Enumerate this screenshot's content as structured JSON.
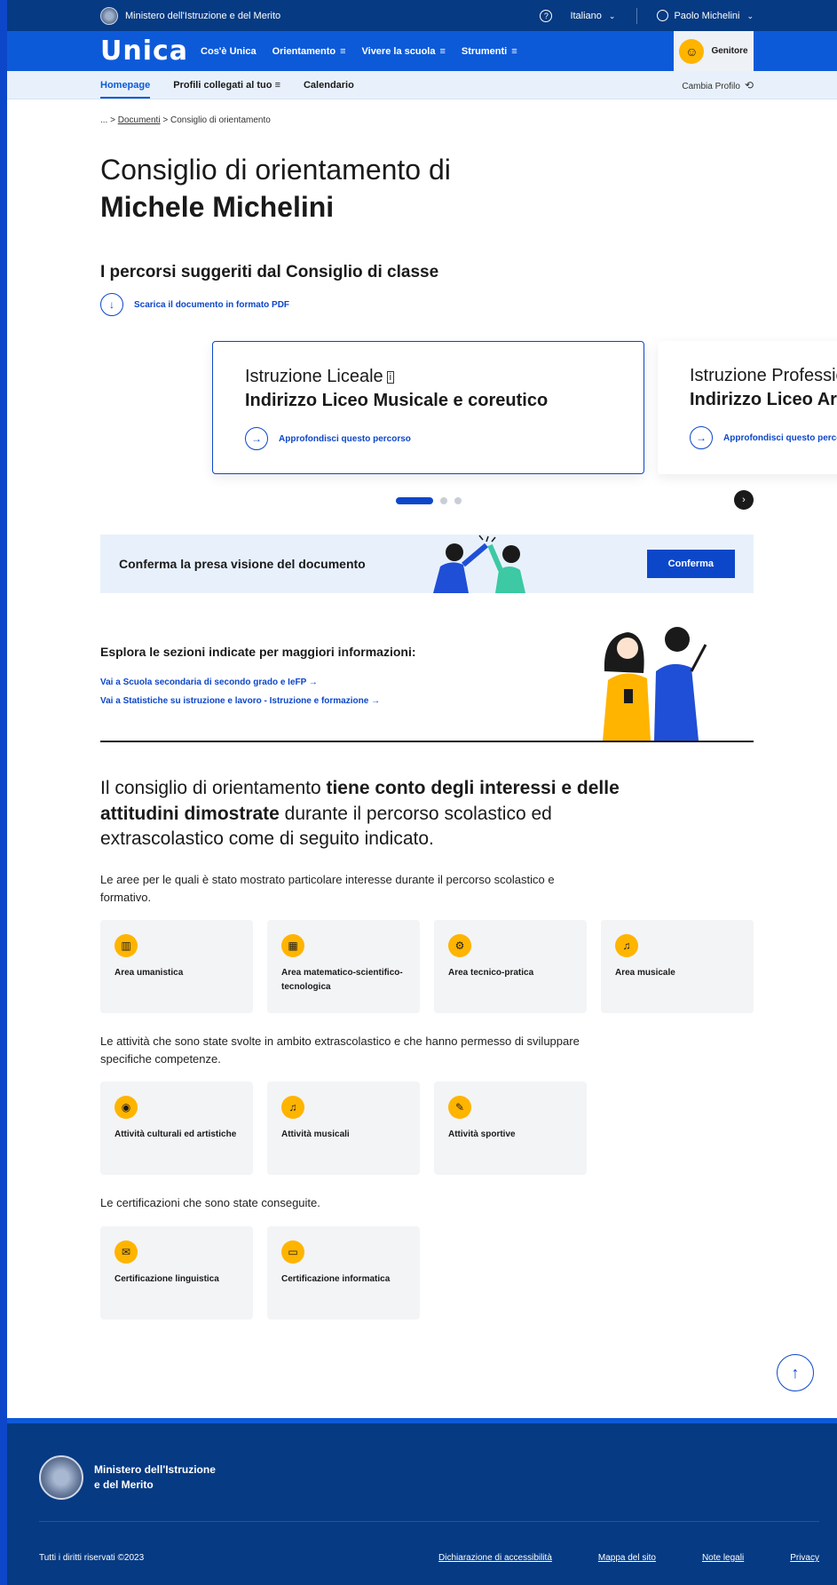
{
  "topbar": {
    "ministry": "Ministero dell'Istruzione e del Merito",
    "language": "Italiano",
    "user": "Paolo Michelini"
  },
  "header": {
    "logo": "Unica",
    "nav": [
      {
        "label": "Cos'è Unica"
      },
      {
        "label": "Orientamento"
      },
      {
        "label": "Vivere la scuola"
      },
      {
        "label": "Strumenti"
      }
    ],
    "role": "Genitore"
  },
  "subnav": {
    "items": [
      "Homepage",
      "Profili collegati al tuo",
      "Calendario"
    ],
    "switch_profile": "Cambia Profilo"
  },
  "breadcrumb": {
    "ellipsis": "...",
    "parent": "Documenti",
    "current": "Consiglio di orientamento"
  },
  "title": {
    "line1": "Consiglio di orientamento di",
    "line2": "Michele Michelini"
  },
  "paths": {
    "heading": "I percorsi suggeriti dal Consiglio di classe",
    "pdf_link": "Scarica il documento in formato PDF",
    "cards": [
      {
        "kicker": "Istruzione Liceale",
        "title": "Indirizzo Liceo Musicale e coreutico",
        "link": "Approfondisci questo percorso"
      },
      {
        "kicker": "Istruzione Professionale",
        "title": "Indirizzo Liceo Artistico",
        "link": "Approfondisci questo percorso"
      }
    ]
  },
  "confirm": {
    "text": "Conferma la presa visione del documento",
    "button": "Conferma"
  },
  "explore": {
    "heading": "Esplora le sezioni indicate per maggiori informazioni:",
    "links": [
      "Vai a Scuola secondaria di secondo grado e IeFP",
      "Vai a Statistiche su istruzione e lavoro - Istruzione e formazione"
    ]
  },
  "orientation": {
    "lead_1": "Il consiglio di orientamento ",
    "lead_bold": "tiene conto degli interessi e delle attitudini dimostrate",
    "lead_2": " durante il percorso scolastico ed extrascolastico come di seguito indicato.",
    "areas_intro": "Le aree per le quali è stato mostrato particolare interesse durante il percorso scolastico e formativo.",
    "areas": [
      "Area umanistica",
      "Area matematico-scientifico-tecnologica",
      "Area tecnico-pratica",
      "Area musicale"
    ],
    "activities_intro": "Le attività che sono state svolte in ambito extrascolastico e che hanno permesso di sviluppare specifiche competenze.",
    "activities": [
      "Attività culturali ed artistiche",
      "Attività musicali",
      "Attività sportive"
    ],
    "certs_intro": "Le certificazioni che sono state conseguite.",
    "certs": [
      "Certificazione linguistica",
      "Certificazione informatica"
    ]
  },
  "footer": {
    "brand": "Ministero dell'Istruzione e del Merito",
    "copyright": "Tutti i diritti riservati ©2023",
    "links": [
      "Dichiarazione di accessibilità",
      "Mappa del sito",
      "Note legali",
      "Privacy"
    ]
  },
  "colors": {
    "primary": "#0d47c9",
    "header": "#0d5ad9",
    "topbar": "#063a82",
    "accent": "#ffb400"
  }
}
